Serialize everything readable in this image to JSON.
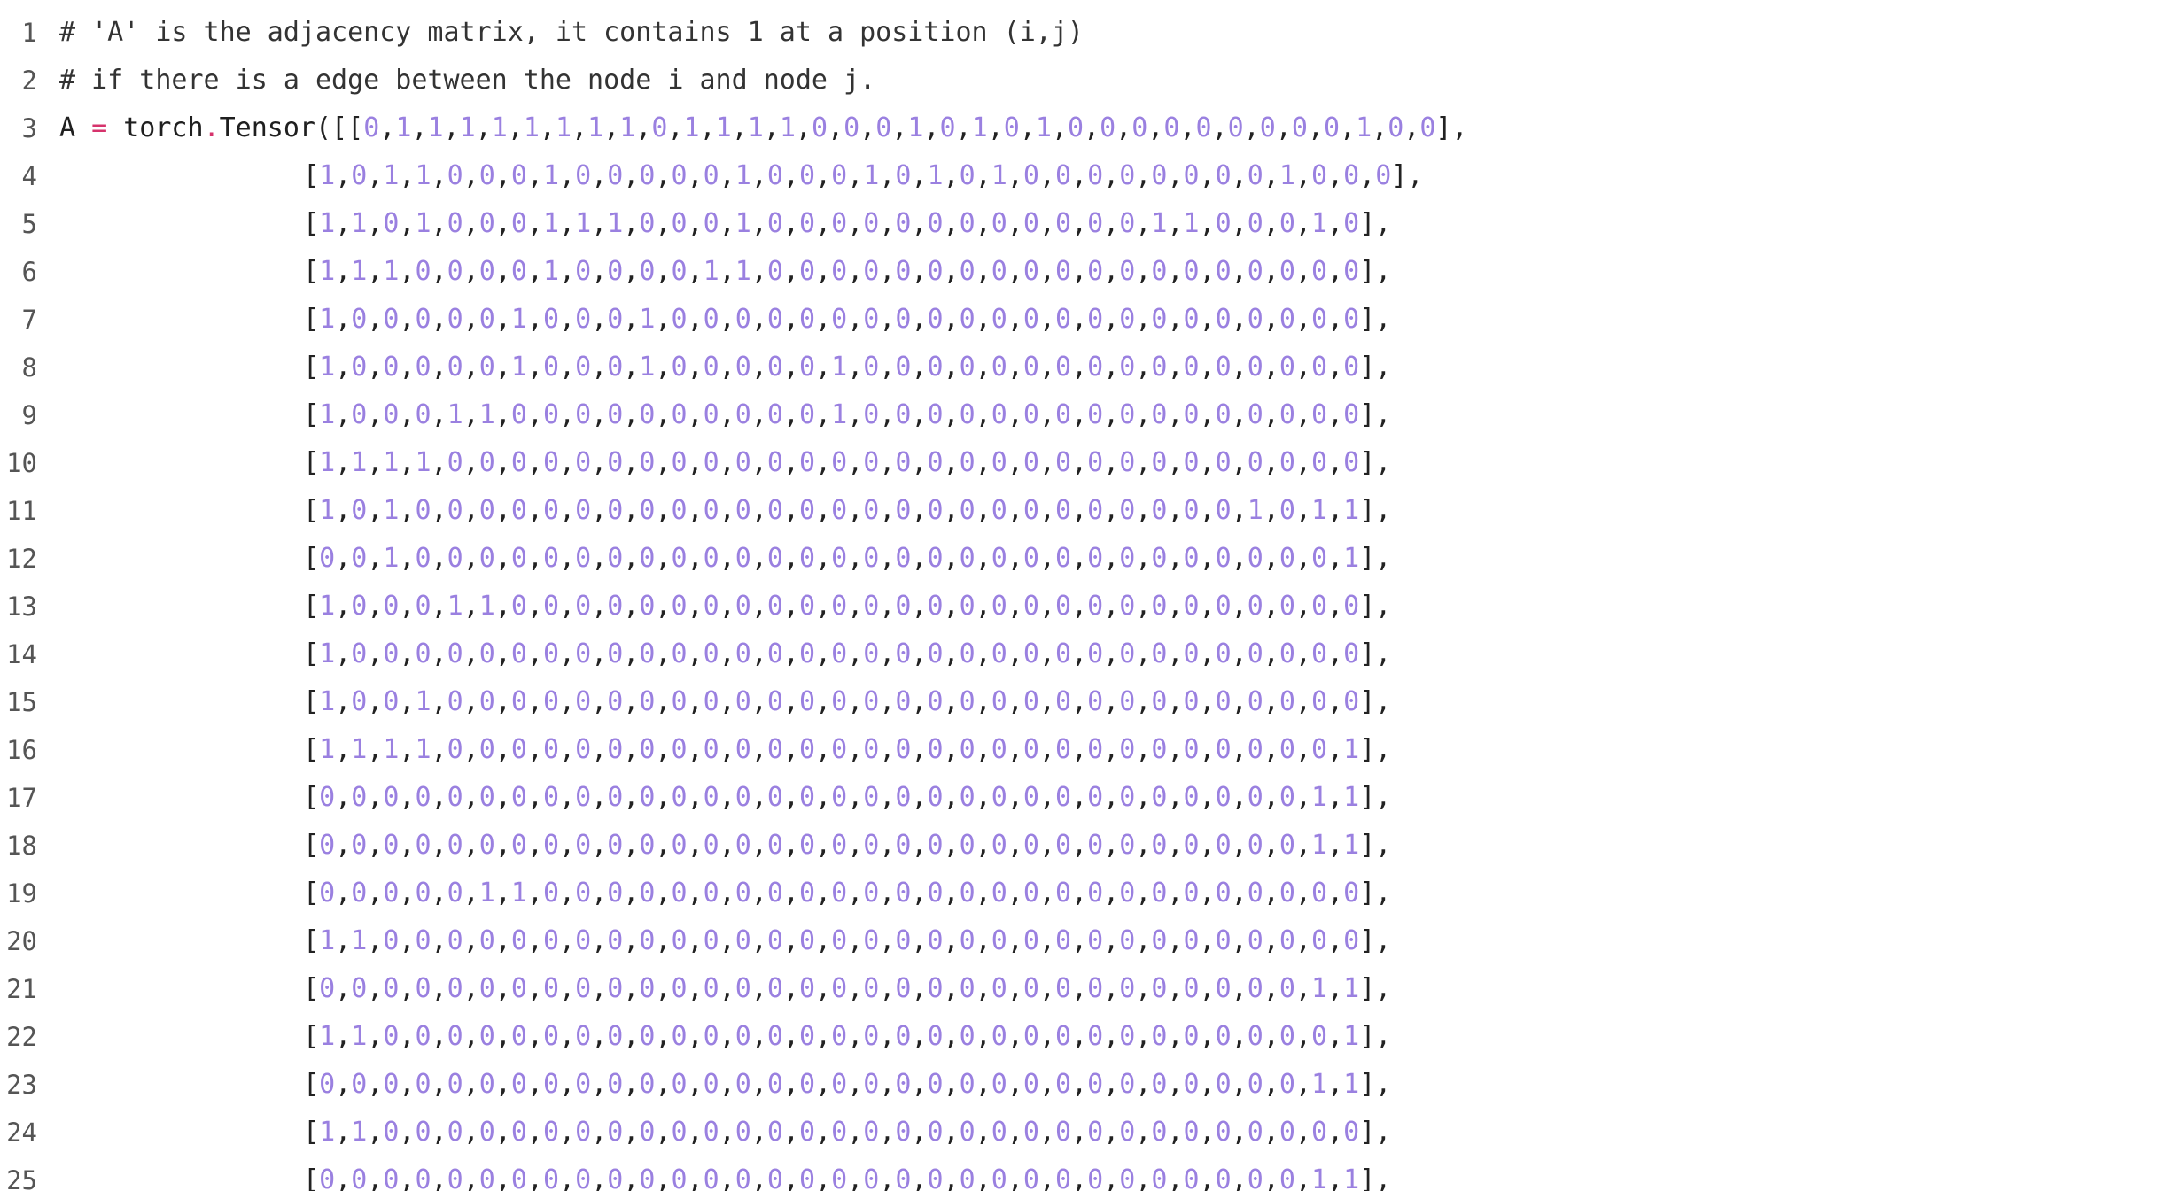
{
  "editor": {
    "colors": {
      "number": "#9a80e0",
      "operator": "#d6336c",
      "text": "#1f1f1f",
      "line_number": "#555555",
      "background": "#ffffff"
    },
    "lines": [
      {
        "n": "1",
        "kind": "comment",
        "text": "# 'A' is the adjacency matrix, it contains 1 at a position (i,j)"
      },
      {
        "n": "2",
        "kind": "comment",
        "text": "# if there is a edge between the node i and node j."
      },
      {
        "n": "3",
        "kind": "decl",
        "prefix": "A",
        "op": "=",
        "call": "torch",
        "method": "Tensor",
        "open": "([[",
        "values": "0,1,1,1,1,1,1,1,1,0,1,1,1,1,0,0,0,1,0,1,0,1,0,0,0,0,0,0,0,0,0,1,0,0",
        "close": "],"
      },
      {
        "n": "4",
        "kind": "row",
        "values": "1,0,1,1,0,0,0,1,0,0,0,0,0,1,0,0,0,1,0,1,0,1,0,0,0,0,0,0,0,0,1,0,0,0"
      },
      {
        "n": "5",
        "kind": "row",
        "values": "1,1,0,1,0,0,0,1,1,1,0,0,0,1,0,0,0,0,0,0,0,0,0,0,0,0,1,1,0,0,0,1,0"
      },
      {
        "n": "6",
        "kind": "row",
        "values": "1,1,1,0,0,0,0,1,0,0,0,0,1,1,0,0,0,0,0,0,0,0,0,0,0,0,0,0,0,0,0,0,0"
      },
      {
        "n": "7",
        "kind": "row",
        "values": "1,0,0,0,0,0,1,0,0,0,1,0,0,0,0,0,0,0,0,0,0,0,0,0,0,0,0,0,0,0,0,0,0"
      },
      {
        "n": "8",
        "kind": "row",
        "values": "1,0,0,0,0,0,1,0,0,0,1,0,0,0,0,0,1,0,0,0,0,0,0,0,0,0,0,0,0,0,0,0,0"
      },
      {
        "n": "9",
        "kind": "row",
        "values": "1,0,0,0,1,1,0,0,0,0,0,0,0,0,0,0,1,0,0,0,0,0,0,0,0,0,0,0,0,0,0,0,0"
      },
      {
        "n": "10",
        "kind": "row",
        "values": "1,1,1,1,0,0,0,0,0,0,0,0,0,0,0,0,0,0,0,0,0,0,0,0,0,0,0,0,0,0,0,0,0"
      },
      {
        "n": "11",
        "kind": "row",
        "values": "1,0,1,0,0,0,0,0,0,0,0,0,0,0,0,0,0,0,0,0,0,0,0,0,0,0,0,0,0,1,0,1,1"
      },
      {
        "n": "12",
        "kind": "row",
        "values": "0,0,1,0,0,0,0,0,0,0,0,0,0,0,0,0,0,0,0,0,0,0,0,0,0,0,0,0,0,0,0,0,1"
      },
      {
        "n": "13",
        "kind": "row",
        "values": "1,0,0,0,1,1,0,0,0,0,0,0,0,0,0,0,0,0,0,0,0,0,0,0,0,0,0,0,0,0,0,0,0"
      },
      {
        "n": "14",
        "kind": "row",
        "values": "1,0,0,0,0,0,0,0,0,0,0,0,0,0,0,0,0,0,0,0,0,0,0,0,0,0,0,0,0,0,0,0,0"
      },
      {
        "n": "15",
        "kind": "row",
        "values": "1,0,0,1,0,0,0,0,0,0,0,0,0,0,0,0,0,0,0,0,0,0,0,0,0,0,0,0,0,0,0,0,0"
      },
      {
        "n": "16",
        "kind": "row",
        "values": "1,1,1,1,0,0,0,0,0,0,0,0,0,0,0,0,0,0,0,0,0,0,0,0,0,0,0,0,0,0,0,0,1"
      },
      {
        "n": "17",
        "kind": "row",
        "values": "0,0,0,0,0,0,0,0,0,0,0,0,0,0,0,0,0,0,0,0,0,0,0,0,0,0,0,0,0,0,0,1,1"
      },
      {
        "n": "18",
        "kind": "row",
        "values": "0,0,0,0,0,0,0,0,0,0,0,0,0,0,0,0,0,0,0,0,0,0,0,0,0,0,0,0,0,0,0,1,1"
      },
      {
        "n": "19",
        "kind": "row",
        "values": "0,0,0,0,0,1,1,0,0,0,0,0,0,0,0,0,0,0,0,0,0,0,0,0,0,0,0,0,0,0,0,0,0"
      },
      {
        "n": "20",
        "kind": "row",
        "values": "1,1,0,0,0,0,0,0,0,0,0,0,0,0,0,0,0,0,0,0,0,0,0,0,0,0,0,0,0,0,0,0,0"
      },
      {
        "n": "21",
        "kind": "row",
        "values": "0,0,0,0,0,0,0,0,0,0,0,0,0,0,0,0,0,0,0,0,0,0,0,0,0,0,0,0,0,0,0,1,1"
      },
      {
        "n": "22",
        "kind": "row",
        "values": "1,1,0,0,0,0,0,0,0,0,0,0,0,0,0,0,0,0,0,0,0,0,0,0,0,0,0,0,0,0,0,0,1"
      },
      {
        "n": "23",
        "kind": "row",
        "values": "0,0,0,0,0,0,0,0,0,0,0,0,0,0,0,0,0,0,0,0,0,0,0,0,0,0,0,0,0,0,0,1,1"
      },
      {
        "n": "24",
        "kind": "row",
        "values": "1,1,0,0,0,0,0,0,0,0,0,0,0,0,0,0,0,0,0,0,0,0,0,0,0,0,0,0,0,0,0,0,0"
      },
      {
        "n": "25",
        "kind": "row",
        "values": "0,0,0,0,0,0,0,0,0,0,0,0,0,0,0,0,0,0,0,0,0,0,0,0,0,0,0,0,0,0,0,1,1"
      }
    ]
  }
}
